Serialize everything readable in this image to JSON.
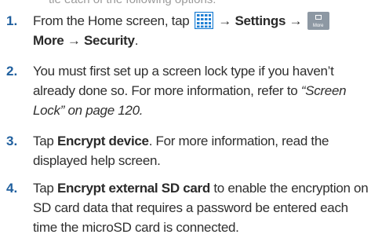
{
  "top_fragment": "tle each of the following options:",
  "steps": [
    {
      "num": "1.",
      "t1": "From the Home screen, tap",
      "arrow1": "→",
      "settings": "Settings",
      "arrow2": "→",
      "more_icon_label": "More",
      "more": "More",
      "arrow3": "→",
      "security": "Security",
      "end": "."
    },
    {
      "num": "2.",
      "t1": "You must first set up a screen lock type if you haven’t already done so. For more information, refer to ",
      "ref": "“Screen Lock”  on page 120.",
      "end": ""
    },
    {
      "num": "3.",
      "t1": "Tap ",
      "bold": "Encrypt device",
      "t2": ". For more information, read the displayed help screen."
    },
    {
      "num": "4.",
      "t1": "Tap ",
      "bold": "Encrypt external SD card",
      "t2": " to enable the encryption on SD card data that requires a password be entered each time the microSD card is connected."
    }
  ],
  "icons": {
    "grid_icon": "apps-grid-icon",
    "more_icon": "more-settings-icon"
  },
  "colors": {
    "step_number": "#1f5f9e",
    "grid_icon": "#1e7fd4",
    "more_icon": "#8d98a3"
  }
}
